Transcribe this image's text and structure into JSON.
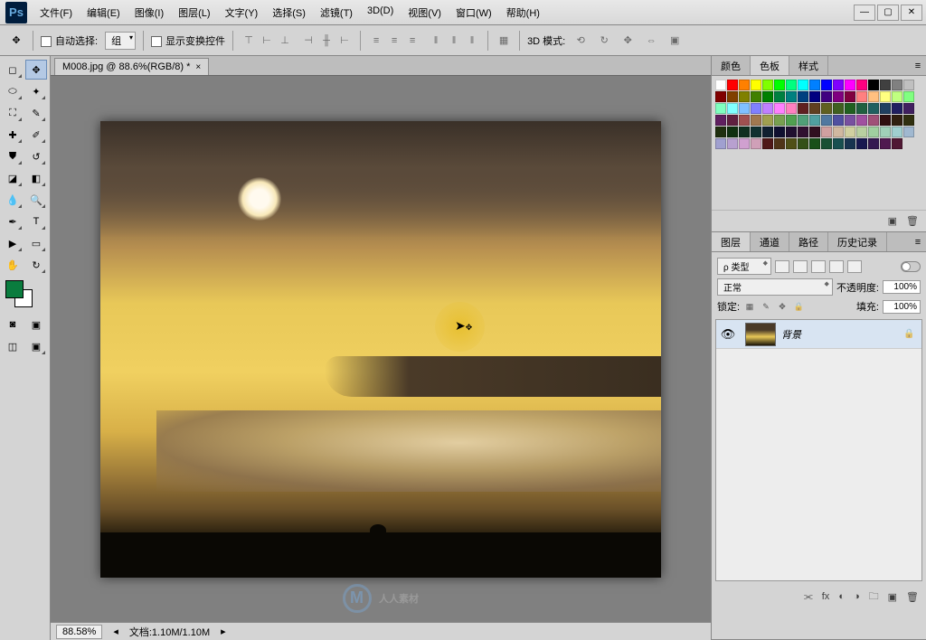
{
  "app_logo": "Ps",
  "menu": [
    "文件(F)",
    "编辑(E)",
    "图像(I)",
    "图层(L)",
    "文字(Y)",
    "选择(S)",
    "滤镜(T)",
    "3D(D)",
    "视图(V)",
    "窗口(W)",
    "帮助(H)"
  ],
  "options": {
    "auto_select": "自动选择:",
    "auto_select_value": "组",
    "show_transform": "显示变换控件",
    "mode3d": "3D 模式:"
  },
  "doc_tab": "M008.jpg @ 88.6%(RGB/8) *",
  "status": {
    "zoom": "88.58%",
    "doc_label": "文档:",
    "doc_value": "1.10M/1.10M"
  },
  "panels": {
    "color": {
      "tabs": [
        "颜色",
        "色板",
        "样式"
      ],
      "active": 1
    },
    "layers": {
      "tabs": [
        "图层",
        "通道",
        "路径",
        "历史记录"
      ],
      "active": 0,
      "kind": "ρ 类型",
      "blend": "正常",
      "opacity_label": "不透明度:",
      "opacity_value": "100%",
      "lock_label": "锁定:",
      "fill_label": "填充:",
      "fill_value": "100%",
      "layer_name": "背景"
    }
  },
  "swatches": [
    "#ffffff",
    "#ff0000",
    "#ff8000",
    "#ffff00",
    "#80ff00",
    "#00ff00",
    "#00ff80",
    "#00ffff",
    "#0080ff",
    "#0000ff",
    "#8000ff",
    "#ff00ff",
    "#ff0080",
    "#000000",
    "#404040",
    "#808080",
    "#c0c0c0",
    "#800000",
    "#804000",
    "#808000",
    "#408000",
    "#008000",
    "#008040",
    "#008080",
    "#004080",
    "#000080",
    "#400080",
    "#800080",
    "#800040",
    "#ff8080",
    "#ffc080",
    "#ffff80",
    "#c0ff80",
    "#80ff80",
    "#80ffc0",
    "#80ffff",
    "#80c0ff",
    "#8080ff",
    "#c080ff",
    "#ff80ff",
    "#ff80c0",
    "#602020",
    "#604020",
    "#606020",
    "#406020",
    "#206020",
    "#206040",
    "#206060",
    "#204060",
    "#202060",
    "#402060",
    "#602060",
    "#602040",
    "#a05050",
    "#a07850",
    "#a0a050",
    "#78a050",
    "#50a050",
    "#50a078",
    "#50a0a0",
    "#5078a0",
    "#5050a0",
    "#7850a0",
    "#a050a0",
    "#a05078",
    "#301010",
    "#302010",
    "#303010",
    "#203010",
    "#103010",
    "#103020",
    "#103030",
    "#102030",
    "#101030",
    "#201030",
    "#301030",
    "#301020",
    "#d0a0a0",
    "#d0b8a0",
    "#d0d0a0",
    "#b8d0a0",
    "#a0d0a0",
    "#a0d0b8",
    "#a0d0d0",
    "#a0b8d0",
    "#a0a0d0",
    "#b8a0d0",
    "#d0a0d0",
    "#d0a0b8",
    "#501818",
    "#503418",
    "#505018",
    "#345018",
    "#185018",
    "#185034",
    "#185050",
    "#183450",
    "#181850",
    "#341850",
    "#501850",
    "#501834"
  ],
  "watermark": "人人素材"
}
